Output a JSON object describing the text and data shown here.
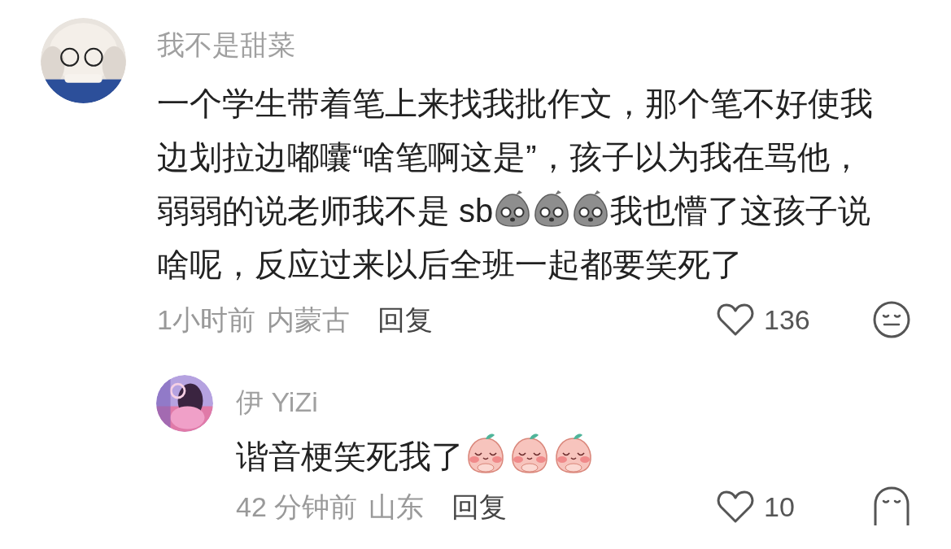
{
  "comments": [
    {
      "avatar": {
        "kind": "picture"
      },
      "name": "我不是甜菜",
      "body": [
        {
          "kind": "text",
          "text": "一个学生带着笔上来找我批作文，那个笔不好使我边划拉边嘟囔“啥笔啊这是”，孩子以为我在骂他，弱弱的说老师我不是 sb"
        },
        {
          "kind": "sticker"
        },
        {
          "kind": "sticker"
        },
        {
          "kind": "sticker"
        },
        {
          "kind": "text",
          "text": "我也懵了这孩子说啥呢，反应过来以后全班一起都要笑死了"
        }
      ],
      "time": "1小时前",
      "location": "内蒙古",
      "reply": "回复",
      "likes": "136",
      "replies": [
        {
          "avatar": {
            "kind": "picture"
          },
          "name": "伊 YiZi",
          "body": [
            {
              "kind": "text",
              "text": "谐音梗笑死我了"
            },
            {
              "kind": "sticker"
            },
            {
              "kind": "sticker"
            },
            {
              "kind": "sticker"
            }
          ],
          "time": "42 分钟前",
          "location": "山东",
          "reply": "回复",
          "likes": "10"
        }
      ]
    }
  ]
}
